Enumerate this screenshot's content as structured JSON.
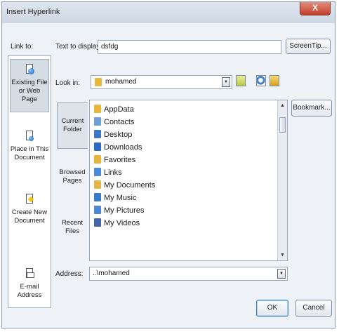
{
  "dialog": {
    "title": "Insert Hyperlink",
    "close_label": "X"
  },
  "link_to": {
    "label": "Link to:",
    "items": [
      {
        "label": "Existing File or Web Page",
        "icon": "web-page-icon"
      },
      {
        "label": "Place in This Document",
        "icon": "document-place-icon"
      },
      {
        "label": "Create New Document",
        "icon": "new-document-icon"
      },
      {
        "label": "E-mail Address",
        "icon": "email-icon"
      }
    ]
  },
  "text_to_display": {
    "label": "Text to display:",
    "value": "dsfdg"
  },
  "screentip_button": "ScreenTip...",
  "look_in": {
    "label": "Look in:",
    "value": "mohamed"
  },
  "places": [
    {
      "label": "Current Folder"
    },
    {
      "label": "Browsed Pages"
    },
    {
      "label": "Recent Files"
    }
  ],
  "files": [
    {
      "name": "AppData",
      "color": "#e8b83a"
    },
    {
      "name": "Contacts",
      "color": "#6f9fd6"
    },
    {
      "name": "Desktop",
      "color": "#3f77c8"
    },
    {
      "name": "Downloads",
      "color": "#2d6bc4"
    },
    {
      "name": "Favorites",
      "color": "#e6b43c"
    },
    {
      "name": "Links",
      "color": "#4a8ad8"
    },
    {
      "name": "My Documents",
      "color": "#e4b547"
    },
    {
      "name": "My Music",
      "color": "#3b78c9"
    },
    {
      "name": "My Pictures",
      "color": "#4f87d2"
    },
    {
      "name": "My Videos",
      "color": "#4465a8"
    }
  ],
  "bookmark_button": "Bookmark...",
  "address": {
    "label": "Address:",
    "value": "..\\mohamed"
  },
  "buttons": {
    "ok": "OK",
    "cancel": "Cancel"
  }
}
